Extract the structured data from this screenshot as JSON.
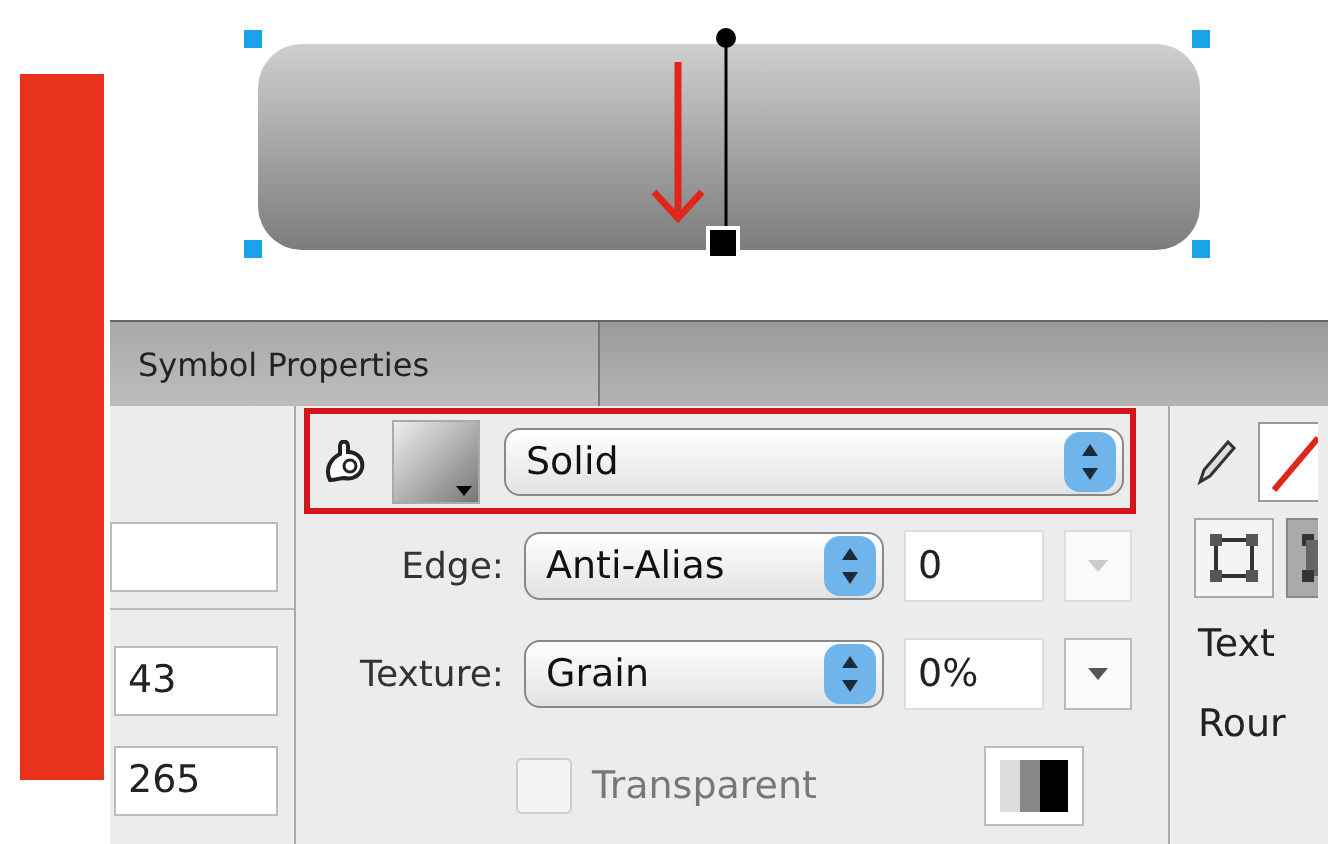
{
  "panel": {
    "tab": {
      "label": "Symbol Properties",
      "selected": true
    },
    "left_fields": [
      {
        "value": "43"
      },
      {
        "value": "265"
      }
    ],
    "fill": {
      "type": "Solid"
    },
    "edge": {
      "label": "Edge:",
      "value": "Anti-Alias",
      "amount": "0",
      "menu_disabled": true
    },
    "texture": {
      "label": "Texture:",
      "value": "Grain",
      "amount": "0%",
      "menu_disabled": false
    },
    "transparent": {
      "label": "Transparent",
      "checked": false,
      "disabled": true
    },
    "right_labels": [
      "Text",
      "Rour"
    ]
  }
}
